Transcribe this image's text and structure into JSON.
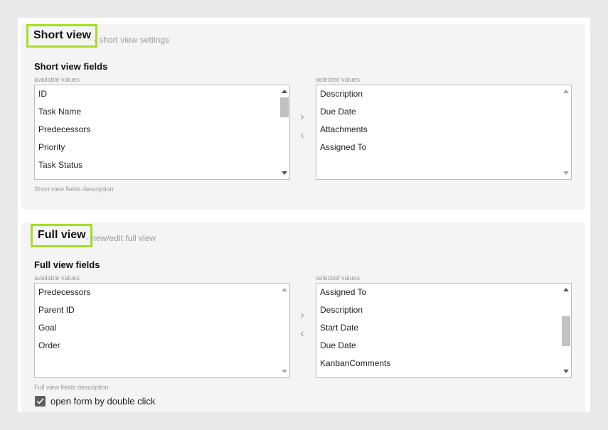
{
  "short_view": {
    "title": "Short view",
    "subtitle": "- short view settings",
    "fields_label": "Short view fields",
    "available_label": "available values",
    "selected_label": "selected values",
    "available": [
      "ID",
      "Task Name",
      "Predecessors",
      "Priority",
      "Task Status"
    ],
    "selected": [
      "Description",
      "Due Date",
      "Attachments",
      "Assigned To"
    ],
    "description": "Short view fields description",
    "move_right": "›",
    "move_left": "‹"
  },
  "full_view": {
    "title": "Full view",
    "subtitle": "- new/edit full view",
    "fields_label": "Full view fields",
    "available_label": "available values",
    "selected_label": "selected values",
    "available": [
      "Predecessors",
      "Parent ID",
      "Goal",
      "Order"
    ],
    "selected": [
      "Assigned To",
      "Description",
      "Start Date",
      "Due Date",
      "KanbanComments"
    ],
    "description": "Full view fields description",
    "move_right": "›",
    "move_left": "‹"
  },
  "options": {
    "open_form_double_click_label": "open form by double click",
    "open_form_double_click_checked": true
  },
  "icons": {
    "scroll_up": "scroll-up-icon",
    "scroll_down": "scroll-down-icon",
    "checkmark": "checkmark-icon"
  },
  "colors": {
    "highlight": "#a7dd22",
    "section_bg": "#f4f4f4",
    "page_bg": "#e9e9ea",
    "checkbox": "#5f5f5f"
  }
}
